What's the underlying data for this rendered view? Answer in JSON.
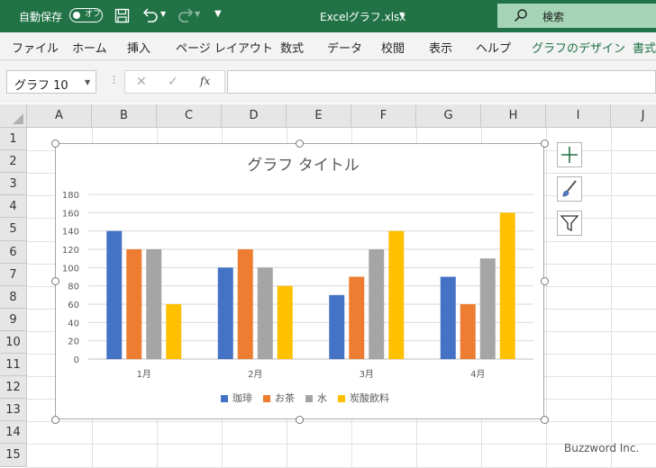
{
  "titlebar": {
    "autosave_label": "自動保存",
    "autosave_state": "オフ",
    "filename": "Excelグラフ.xlsx",
    "search_label": "検索"
  },
  "ribbon": {
    "tabs": [
      "ファイル",
      "ホーム",
      "挿入",
      "ページ レイアウト",
      "数式",
      "データ",
      "校閲",
      "表示",
      "ヘルプ",
      "グラフのデザイン",
      "書式"
    ]
  },
  "formula_bar": {
    "name_box": "グラフ 10",
    "formula": ""
  },
  "columns": [
    "A",
    "B",
    "C",
    "D",
    "E",
    "F",
    "G",
    "H",
    "I",
    "J"
  ],
  "rows": [
    "1",
    "2",
    "3",
    "4",
    "5",
    "6",
    "7",
    "8",
    "9",
    "10",
    "11",
    "12",
    "13",
    "14",
    "15"
  ],
  "chart_data": {
    "type": "bar",
    "title": "グラフ タイトル",
    "categories": [
      "1月",
      "2月",
      "3月",
      "4月"
    ],
    "series": [
      {
        "name": "珈琲",
        "values": [
          140,
          100,
          70,
          90
        ],
        "color": "#4472c4"
      },
      {
        "name": "お茶",
        "values": [
          120,
          120,
          90,
          60
        ],
        "color": "#ed7d31"
      },
      {
        "name": "水",
        "values": [
          120,
          100,
          120,
          110
        ],
        "color": "#a5a5a5"
      },
      {
        "name": "炭酸飲料",
        "values": [
          60,
          80,
          140,
          160
        ],
        "color": "#ffc000"
      }
    ],
    "ylim": [
      0,
      180
    ],
    "yticks": [
      "0",
      "20",
      "40",
      "60",
      "80",
      "100",
      "120",
      "140",
      "160",
      "180"
    ],
    "grid": true,
    "legend": "bottom"
  },
  "chart_tools": [
    "chart-elements",
    "chart-styles",
    "chart-filters"
  ],
  "watermark": "Buzzword Inc."
}
